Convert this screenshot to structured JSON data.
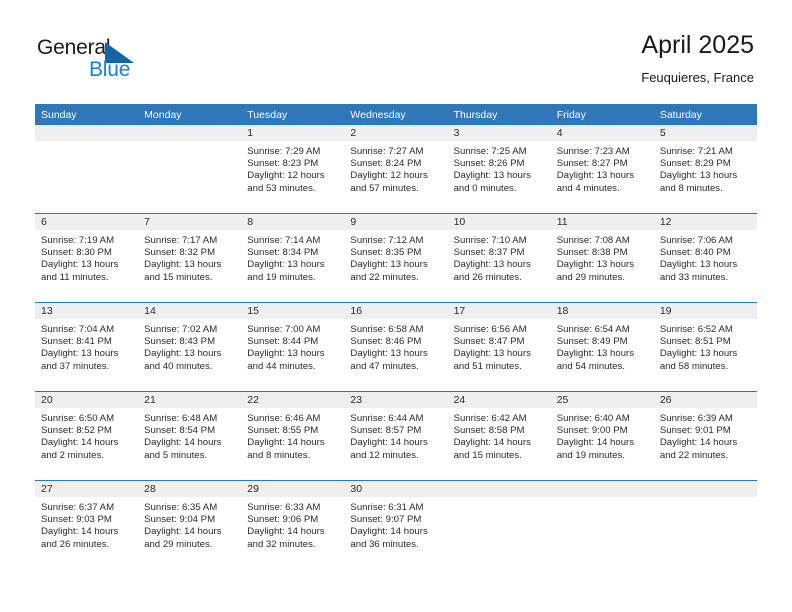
{
  "brand": {
    "word_one": "General",
    "word_two": "Blue",
    "triangle_icon": "blue-triangle-icon",
    "color_dark": "#1b1b1b",
    "color_blue": "#1b7fd4",
    "color_triangle": "#1763a8"
  },
  "header": {
    "title": "April 2025",
    "subtitle": "Feuquieres, France"
  },
  "theme": {
    "header_blue": "#2f77b8",
    "daynum_band": "#efefef",
    "cell_bg": "#ffffff",
    "text": "#2b2b2b"
  },
  "weekday_headers": [
    "Sunday",
    "Monday",
    "Tuesday",
    "Wednesday",
    "Thursday",
    "Friday",
    "Saturday"
  ],
  "weeks": [
    [
      {
        "day": "",
        "empty": true,
        "sunrise": "",
        "sunset": "",
        "daylight_line1": "",
        "daylight_line2": ""
      },
      {
        "day": "",
        "empty": true,
        "sunrise": "",
        "sunset": "",
        "daylight_line1": "",
        "daylight_line2": ""
      },
      {
        "day": "1",
        "sunrise": "Sunrise: 7:29 AM",
        "sunset": "Sunset: 8:23 PM",
        "daylight_line1": "Daylight: 12 hours",
        "daylight_line2": "and 53 minutes."
      },
      {
        "day": "2",
        "sunrise": "Sunrise: 7:27 AM",
        "sunset": "Sunset: 8:24 PM",
        "daylight_line1": "Daylight: 12 hours",
        "daylight_line2": "and 57 minutes."
      },
      {
        "day": "3",
        "sunrise": "Sunrise: 7:25 AM",
        "sunset": "Sunset: 8:26 PM",
        "daylight_line1": "Daylight: 13 hours",
        "daylight_line2": "and 0 minutes."
      },
      {
        "day": "4",
        "sunrise": "Sunrise: 7:23 AM",
        "sunset": "Sunset: 8:27 PM",
        "daylight_line1": "Daylight: 13 hours",
        "daylight_line2": "and 4 minutes."
      },
      {
        "day": "5",
        "sunrise": "Sunrise: 7:21 AM",
        "sunset": "Sunset: 8:29 PM",
        "daylight_line1": "Daylight: 13 hours",
        "daylight_line2": "and 8 minutes."
      }
    ],
    [
      {
        "day": "6",
        "sunrise": "Sunrise: 7:19 AM",
        "sunset": "Sunset: 8:30 PM",
        "daylight_line1": "Daylight: 13 hours",
        "daylight_line2": "and 11 minutes."
      },
      {
        "day": "7",
        "sunrise": "Sunrise: 7:17 AM",
        "sunset": "Sunset: 8:32 PM",
        "daylight_line1": "Daylight: 13 hours",
        "daylight_line2": "and 15 minutes."
      },
      {
        "day": "8",
        "sunrise": "Sunrise: 7:14 AM",
        "sunset": "Sunset: 8:34 PM",
        "daylight_line1": "Daylight: 13 hours",
        "daylight_line2": "and 19 minutes."
      },
      {
        "day": "9",
        "sunrise": "Sunrise: 7:12 AM",
        "sunset": "Sunset: 8:35 PM",
        "daylight_line1": "Daylight: 13 hours",
        "daylight_line2": "and 22 minutes."
      },
      {
        "day": "10",
        "sunrise": "Sunrise: 7:10 AM",
        "sunset": "Sunset: 8:37 PM",
        "daylight_line1": "Daylight: 13 hours",
        "daylight_line2": "and 26 minutes."
      },
      {
        "day": "11",
        "sunrise": "Sunrise: 7:08 AM",
        "sunset": "Sunset: 8:38 PM",
        "daylight_line1": "Daylight: 13 hours",
        "daylight_line2": "and 29 minutes."
      },
      {
        "day": "12",
        "sunrise": "Sunrise: 7:06 AM",
        "sunset": "Sunset: 8:40 PM",
        "daylight_line1": "Daylight: 13 hours",
        "daylight_line2": "and 33 minutes."
      }
    ],
    [
      {
        "day": "13",
        "sunrise": "Sunrise: 7:04 AM",
        "sunset": "Sunset: 8:41 PM",
        "daylight_line1": "Daylight: 13 hours",
        "daylight_line2": "and 37 minutes."
      },
      {
        "day": "14",
        "sunrise": "Sunrise: 7:02 AM",
        "sunset": "Sunset: 8:43 PM",
        "daylight_line1": "Daylight: 13 hours",
        "daylight_line2": "and 40 minutes."
      },
      {
        "day": "15",
        "sunrise": "Sunrise: 7:00 AM",
        "sunset": "Sunset: 8:44 PM",
        "daylight_line1": "Daylight: 13 hours",
        "daylight_line2": "and 44 minutes."
      },
      {
        "day": "16",
        "sunrise": "Sunrise: 6:58 AM",
        "sunset": "Sunset: 8:46 PM",
        "daylight_line1": "Daylight: 13 hours",
        "daylight_line2": "and 47 minutes."
      },
      {
        "day": "17",
        "sunrise": "Sunrise: 6:56 AM",
        "sunset": "Sunset: 8:47 PM",
        "daylight_line1": "Daylight: 13 hours",
        "daylight_line2": "and 51 minutes."
      },
      {
        "day": "18",
        "sunrise": "Sunrise: 6:54 AM",
        "sunset": "Sunset: 8:49 PM",
        "daylight_line1": "Daylight: 13 hours",
        "daylight_line2": "and 54 minutes."
      },
      {
        "day": "19",
        "sunrise": "Sunrise: 6:52 AM",
        "sunset": "Sunset: 8:51 PM",
        "daylight_line1": "Daylight: 13 hours",
        "daylight_line2": "and 58 minutes."
      }
    ],
    [
      {
        "day": "20",
        "sunrise": "Sunrise: 6:50 AM",
        "sunset": "Sunset: 8:52 PM",
        "daylight_line1": "Daylight: 14 hours",
        "daylight_line2": "and 2 minutes."
      },
      {
        "day": "21",
        "sunrise": "Sunrise: 6:48 AM",
        "sunset": "Sunset: 8:54 PM",
        "daylight_line1": "Daylight: 14 hours",
        "daylight_line2": "and 5 minutes."
      },
      {
        "day": "22",
        "sunrise": "Sunrise: 6:46 AM",
        "sunset": "Sunset: 8:55 PM",
        "daylight_line1": "Daylight: 14 hours",
        "daylight_line2": "and 8 minutes."
      },
      {
        "day": "23",
        "sunrise": "Sunrise: 6:44 AM",
        "sunset": "Sunset: 8:57 PM",
        "daylight_line1": "Daylight: 14 hours",
        "daylight_line2": "and 12 minutes."
      },
      {
        "day": "24",
        "sunrise": "Sunrise: 6:42 AM",
        "sunset": "Sunset: 8:58 PM",
        "daylight_line1": "Daylight: 14 hours",
        "daylight_line2": "and 15 minutes."
      },
      {
        "day": "25",
        "sunrise": "Sunrise: 6:40 AM",
        "sunset": "Sunset: 9:00 PM",
        "daylight_line1": "Daylight: 14 hours",
        "daylight_line2": "and 19 minutes."
      },
      {
        "day": "26",
        "sunrise": "Sunrise: 6:39 AM",
        "sunset": "Sunset: 9:01 PM",
        "daylight_line1": "Daylight: 14 hours",
        "daylight_line2": "and 22 minutes."
      }
    ],
    [
      {
        "day": "27",
        "sunrise": "Sunrise: 6:37 AM",
        "sunset": "Sunset: 9:03 PM",
        "daylight_line1": "Daylight: 14 hours",
        "daylight_line2": "and 26 minutes."
      },
      {
        "day": "28",
        "sunrise": "Sunrise: 6:35 AM",
        "sunset": "Sunset: 9:04 PM",
        "daylight_line1": "Daylight: 14 hours",
        "daylight_line2": "and 29 minutes."
      },
      {
        "day": "29",
        "sunrise": "Sunrise: 6:33 AM",
        "sunset": "Sunset: 9:06 PM",
        "daylight_line1": "Daylight: 14 hours",
        "daylight_line2": "and 32 minutes."
      },
      {
        "day": "30",
        "sunrise": "Sunrise: 6:31 AM",
        "sunset": "Sunset: 9:07 PM",
        "daylight_line1": "Daylight: 14 hours",
        "daylight_line2": "and 36 minutes."
      },
      {
        "day": "",
        "empty": true,
        "sunrise": "",
        "sunset": "",
        "daylight_line1": "",
        "daylight_line2": ""
      },
      {
        "day": "",
        "empty": true,
        "sunrise": "",
        "sunset": "",
        "daylight_line1": "",
        "daylight_line2": ""
      },
      {
        "day": "",
        "empty": true,
        "sunrise": "",
        "sunset": "",
        "daylight_line1": "",
        "daylight_line2": ""
      }
    ]
  ]
}
